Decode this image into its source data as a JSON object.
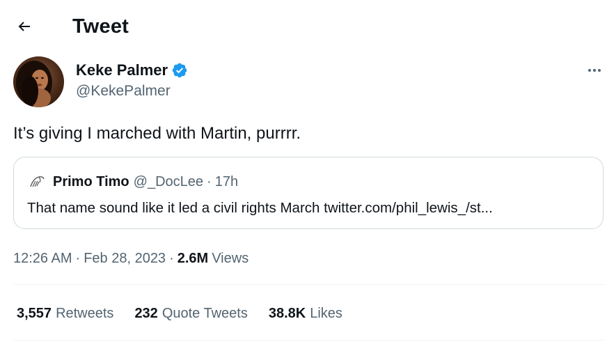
{
  "header": {
    "back_icon": "arrow-left-icon",
    "title": "Tweet"
  },
  "author": {
    "display_name": "Keke Palmer",
    "handle": "@KekePalmer",
    "verified_icon": "verified-badge-icon",
    "more_icon": "more-horizontal-icon"
  },
  "tweet": {
    "text": "It’s giving I marched with Martin, purrrr."
  },
  "quote": {
    "name": "Primo Timo",
    "handle": "@_DocLee",
    "dot": "·",
    "time": "17h",
    "text": "That name sound like it led a civil rights March twitter.com/phil_lewis_/st..."
  },
  "meta": {
    "time": "12:26 AM",
    "dot1": "·",
    "date": "Feb 28, 2023",
    "dot2": "·",
    "views_count": "2.6M",
    "views_label": "Views"
  },
  "stats": {
    "retweets": {
      "count": "3,557",
      "label": "Retweets"
    },
    "quotes": {
      "count": "232",
      "label": "Quote Tweets"
    },
    "likes": {
      "count": "38.8K",
      "label": "Likes"
    }
  },
  "colors": {
    "text": "#0f1419",
    "secondary": "#536471",
    "verified": "#1d9bf0",
    "border": "#cfd9de",
    "divider": "#eff3f4"
  }
}
